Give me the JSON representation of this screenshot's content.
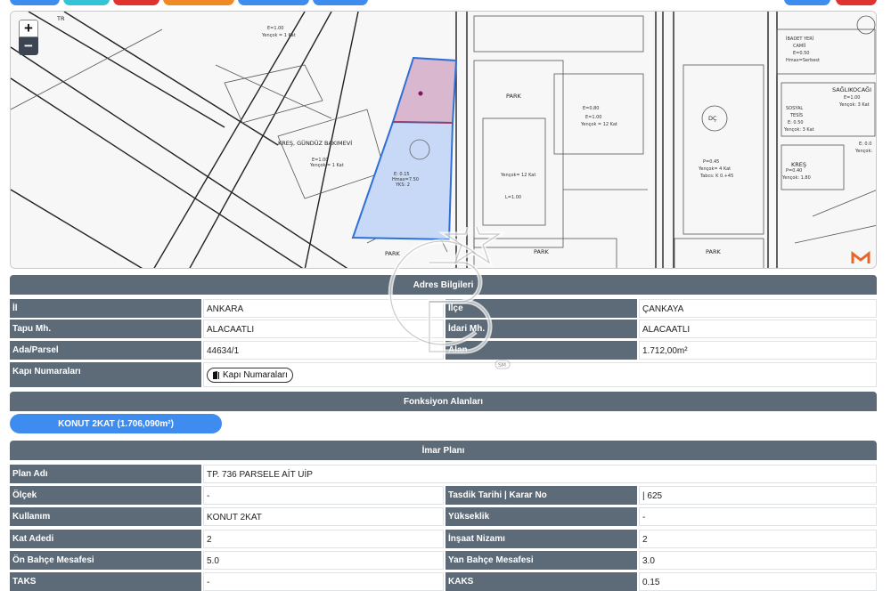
{
  "map": {
    "zoom_in": "+",
    "zoom_out": "−",
    "labels": {
      "kres_gunduz": "KREŞ, GÜNDÜZ BAKIMEVİ",
      "park1": "PARK",
      "park2": "PARK",
      "park3": "PARK",
      "park4": "PARK",
      "dc": "DÇ",
      "saglik": "SAĞLIKOCAĞI",
      "kres2": "KREŞ",
      "tr": "TR"
    },
    "colors": {
      "pink_parcel": "#d9b7cf",
      "blue_parcel": "#c7d9f6",
      "parcel_border": "#2e6fd8",
      "divider": "#d62b2b"
    }
  },
  "adres": {
    "title": "Adres Bilgileri",
    "il_label": "İl",
    "il_value": "ANKARA",
    "ilce_label": "İlçe",
    "ilce_value": "ÇANKAYA",
    "tapu_label": "Tapu Mh.",
    "tapu_value": "ALACAATLI",
    "idari_label": "İdari Mh.",
    "idari_value": "ALACAATLI",
    "ada_label": "Ada/Parsel",
    "ada_value": "44634/1",
    "alan_label": "Alan",
    "alan_value": "1.712,00m²",
    "kapi_label": "Kapı Numaraları",
    "kapi_button": "Kapı Numaraları"
  },
  "fonksiyon": {
    "title": "Fonksiyon Alanları",
    "pill": "KONUT 2KAT (1.706,090m²)"
  },
  "imar": {
    "title": "İmar Planı",
    "plan_adi_label": "Plan Adı",
    "plan_adi_value": "TP. 736 PARSELE AİT UİP",
    "olcek_label": "Ölçek",
    "olcek_value": "-",
    "tasdik_label": "Tasdik Tarihi | Karar No",
    "tasdik_value": "| 625",
    "kullanim_label": "Kullanım",
    "kullanim_value": "KONUT 2KAT",
    "yukseklik_label": "Yükseklik",
    "yukseklik_value": "-",
    "kat_label": "Kat Adedi",
    "kat_value": "2",
    "insaat_label": "İnşaat Nizamı",
    "insaat_value": "2",
    "on_label": "Ön Bahçe Mesafesi",
    "on_value": "5.0",
    "yan_label": "Yan Bahçe Mesafesi",
    "yan_value": "3.0",
    "taks_label": "TAKS",
    "taks_value": "-",
    "kaks_label": "KAKS",
    "kaks_value": "0.15"
  },
  "watermark": {
    "sm": "SM"
  },
  "top_buttons": {
    "colors": [
      "#3f8cf0",
      "#35c3d8",
      "#e0322e",
      "#f08a24",
      "#3f8cf0",
      "#3f8cf0",
      "#3f8cf0",
      "#e0322e"
    ]
  }
}
